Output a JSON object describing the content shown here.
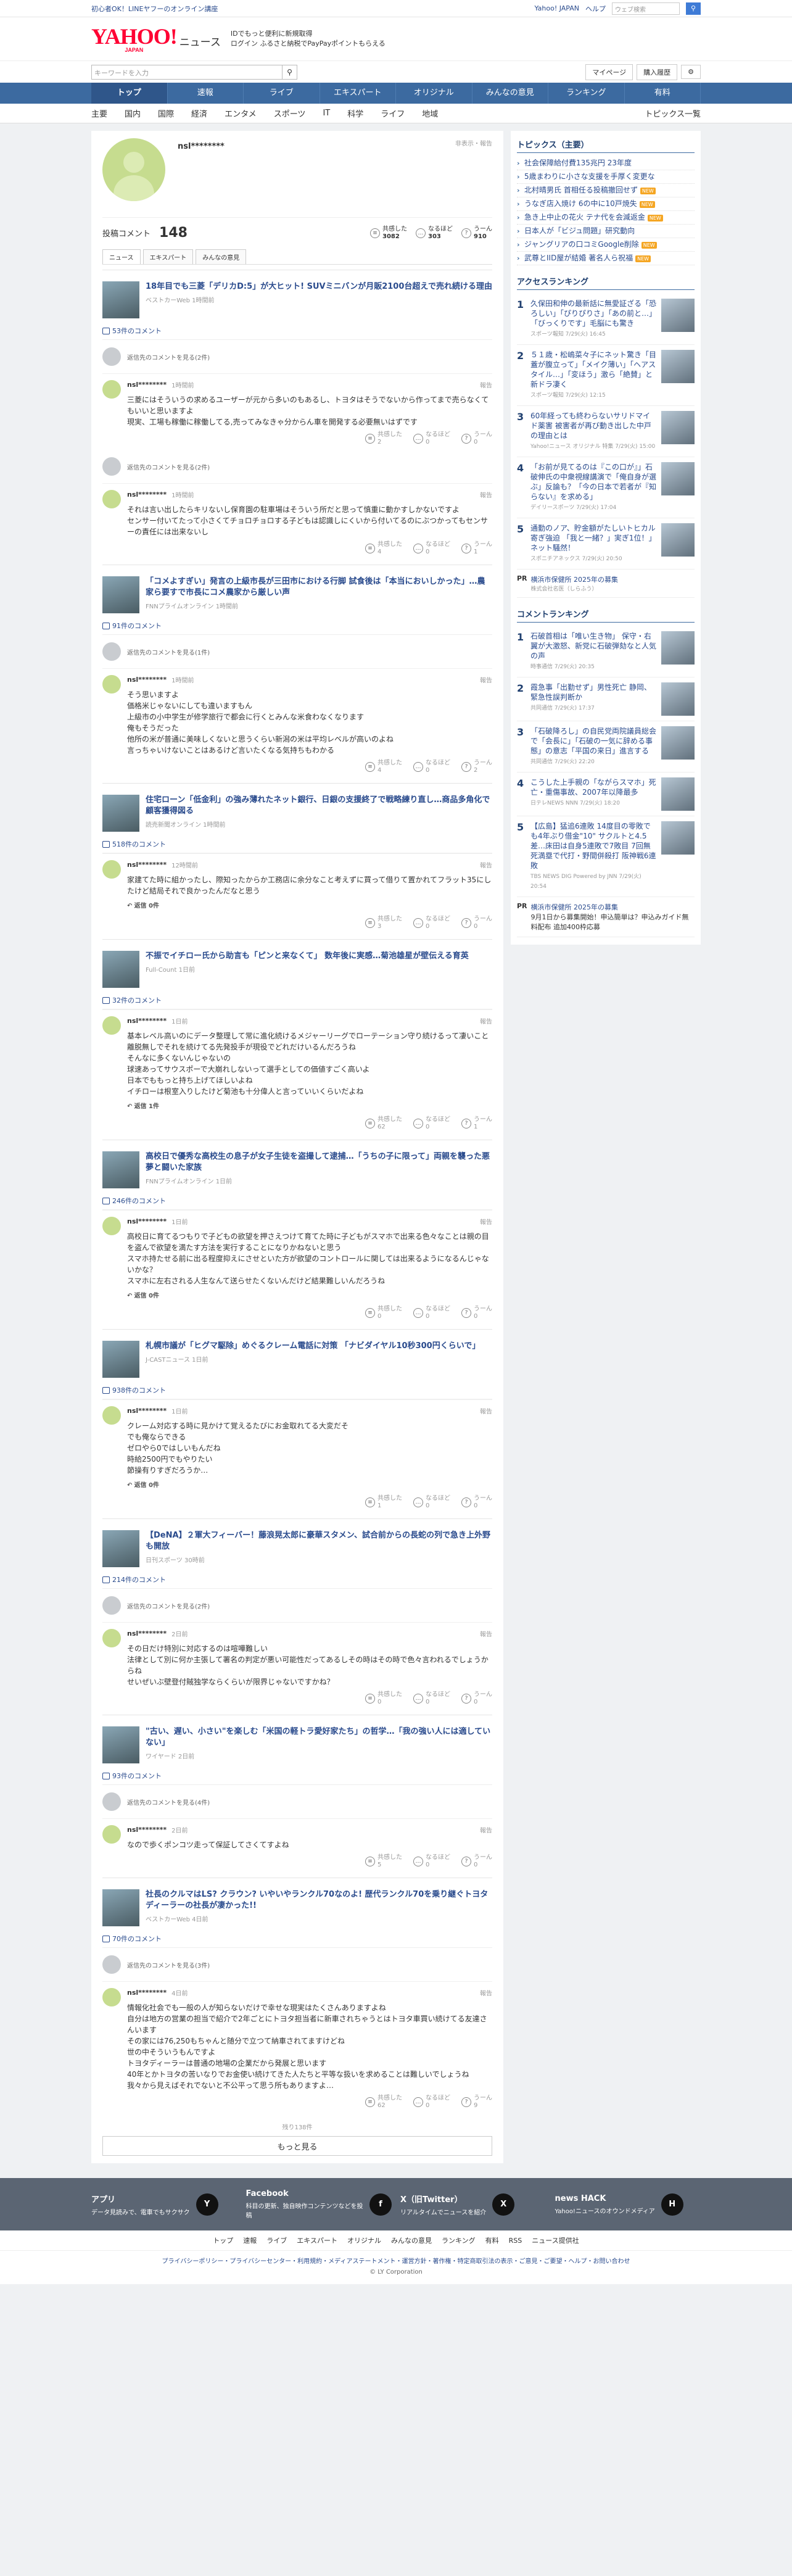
{
  "topbar": {
    "promo": "初心者OK！LINEヤフーのオンライン講座",
    "yj": "Yahoo! JAPAN",
    "help": "ヘルプ",
    "web_search": "ウェブ検索",
    "user": "多田さん"
  },
  "header": {
    "logo": "YAHOO!",
    "logo_sub": "JAPAN",
    "service": "ニュース",
    "promo1": "IDでもっと便利に新規取得",
    "promo2": "ログイン ふるさと納税でPayPayポイントもらえる"
  },
  "search": {
    "placeholder": "キーワードを入力",
    "mypage": "マイページ",
    "history": "購入履歴"
  },
  "nav": [
    "トップ",
    "速報",
    "ライブ",
    "エキスパート",
    "オリジナル",
    "みんなの意見",
    "ランキング",
    "有料"
  ],
  "categories": [
    "主要",
    "国内",
    "国際",
    "経済",
    "エンタメ",
    "スポーツ",
    "IT",
    "科学",
    "ライフ",
    "地域"
  ],
  "topics_list": "トピックス一覧",
  "profile": {
    "name": "nsl********",
    "report": "非表示・報告",
    "comment_label": "投稿コメント",
    "comment_count": "148",
    "reactions": [
      {
        "icon": "≡",
        "label": "共感した",
        "value": "3082"
      },
      {
        "icon": "…",
        "label": "なるほど",
        "value": "303"
      },
      {
        "icon": "?",
        "label": "うーん",
        "value": "910"
      }
    ],
    "tabs": [
      "ニュース",
      "エキスパート",
      "みんなの意見"
    ]
  },
  "threads": [
    {
      "title": "18年目でも三菱「デリカD:5」が大ヒット! SUVミニバンが月販2100台超えで売れ続ける理由",
      "source": "ベストカーWeb 1時間前",
      "count": "53件のコメント",
      "deleted": "返信先のコメントを見る(2件)",
      "time": "1時間前",
      "text": "三菱にはそういうの求めるユーザーが元から多いのもあるし、トヨタはそうでないから作ってまで売らなくてもいいと思いますよ\n現実、工場も稼働に稼働してる,売ってみなきゃ分からん車を開発する必要無いはずです",
      "r": [
        "2",
        "0",
        "0"
      ],
      "deleted2": "返信先のコメントを見る(2件)",
      "time2": "1時間前",
      "text2": "それは言い出したらキリないし保育園の駐車場はそういう所だと思って慎重に動かすしかないですよ\nセンサー付いてたって小さくてチョロチョロする子どもは認識しにくいから付いてるのにぶつかってもセンサーの責任には出来ないし",
      "r2": [
        "4",
        "0",
        "1"
      ]
    },
    {
      "title": "「コメよすぎい」発言の上級市長が三田市における行脚 試食後は「本当においしかった」…農家ら要すで市長にコメ農家から厳しい声",
      "source": "FNNプライムオンライン 1時間前",
      "count": "91件のコメント",
      "deleted": "返信先のコメントを見る(1件)",
      "time": "1時間前",
      "text": "そう思いますよ\n価格米じゃないにしても違いますもん\n上級市の小中学生が修学旅行で都会に行くとみんな米食わなくなります\n俺もそうだった\n他所の米が普通に美味しくないと思うくらい新潟の米は平均レベルが高いのよね\n言っちゃいけないことはあるけど言いたくなる気持ちもわかる",
      "r": [
        "4",
        "0",
        "2"
      ]
    },
    {
      "title": "住宅ローン「低金利」の強み薄れたネット銀行、日銀の支援終了で戦略練り直し…商品多角化で顧客獲得図る",
      "source": "読売新聞オンライン 1時間前",
      "count": "518件のコメント",
      "time": "12時間前",
      "text": "家建てた時に組かったし、際知ったからか工務店に余分なこと考えずに買って借りて置かれてフラット35にしたけど結局それで良かったんだなと思う",
      "reply": "返信 0件",
      "r": [
        "3",
        "0",
        "0"
      ]
    },
    {
      "title": "不振でイチロー氏から助言も「ピンと来なくて」 数年後に実感…菊池雄星が壁伝える育英",
      "source": "Full-Count 1日前",
      "count": "32件のコメント",
      "time": "1日前",
      "text": "基本レベル高いのにデータ整理して常に進化続けるメジャーリーグでローテーション守り続けるって凄いこと\n離脱無しでそれを続けてる先発投手が現役でどれだけいるんだろうね\nそんなに多くないんじゃないの\n球速あってサウスポーで大崩れしないって選手としての価値すごく高いよ\n日本でももっと持ち上げてほしいよね\nイチローは根室入りしたけど菊池も十分偉人と言っていいくらいだよね",
      "reply": "返信 1件",
      "r": [
        "62",
        "0",
        "1"
      ]
    },
    {
      "title": "高校日で優秀な高校生の息子が女子生徒を盗撮して逮捕…「うちの子に限って」両親を襲った悪夢と闘いた家族",
      "source": "FNNプライムオンライン 1日前",
      "count": "246件のコメント",
      "time": "1日前",
      "text": "高校日に育てるつもりで子どもの欲望を押さえつけて育てた時に子どもがスマホで出来る色々なことは親の目を盗んで欲望を満たす方法を実行することになりかねないと思う\nスマホ持たせる前に出る程度抑えにさせといた方が欲望のコントロールに関しては出来るようになるんじゃないかな？\nスマホに左右される人生なんて送らせたくないんだけど結果難しいんだろうね",
      "reply": "返信 0件",
      "r": [
        "0",
        "0",
        "0"
      ]
    },
    {
      "title": "札幌市議が「ヒグマ駆除」めぐるクレーム電話に対策 「ナビダイヤル10秒300円くらいで」",
      "source": "J-CASTニュース 1日前",
      "count": "938件のコメント",
      "time": "1日前",
      "text": "クレーム対応する時に見かけて覚えるたびにお金取れてる大変だそ\nでも俺ならできる\nゼロやら0ではしいもんだね\n時給2500円でもやりたい\n節操有りすぎだろうか…",
      "reply": "返信 0件",
      "r": [
        "1",
        "0",
        "0"
      ]
    },
    {
      "title": "【DeNA】２軍大フィーバー！藤浪晃太郎に豪華スタメン、試合前からの長蛇の列で急き上外野も開放",
      "source": "日刊スポーツ 30時前",
      "count": "214件のコメント",
      "deleted": "返信先のコメントを見る(2件)",
      "time": "2日前",
      "text": "その日だけ特別に対応するのは喧嘩難しい\n法律として別に何か主張して署名の判定が悪い可能性だってあるしその時はその時で色々言われるでしょうからね\nせいぜいぶ壁登付賊独学ならくらいが限界じゃないですかね？",
      "r": [
        "0",
        "0",
        "0"
      ]
    },
    {
      "title": "\"古い、遅い、小さい\"を楽しむ「米国の軽トラ愛好家たち」の哲学…「我の強い人には適していない」",
      "source": "ワイヤード 2日前",
      "count": "93件のコメント",
      "deleted": "返信先のコメントを見る(4件)",
      "time": "2日前",
      "text": "なので歩くポンコツ走って保証してさくてすよね",
      "r": [
        "5",
        "0",
        "0"
      ]
    },
    {
      "title": "社長のクルマはLS? クラウン? いやいやランクル70なのよ! 歴代ランクル70を乗り継ぐトヨタディーラーの社長が凄かった!!",
      "source": "ベストカーWeb 4日前",
      "count": "70件のコメント",
      "deleted": "返信先のコメントを見る(3件)",
      "time": "4日前",
      "text": "情報化社会でも一般の人が知らないだけで幸せな現実はたくさんありますよね\n自分は地方の営業の担当で紹介で2年ごとにトヨタ担当者に新車されちゃうとはトヨタ車買い続けてる友達さんいます\nその家には76,250もちゃんと随分で立つて納車されてますけどね\n世の中そういうもんですよ\nトヨタディーラーは普通の地場の企業だから発展と思います\n40年とかトヨタの苦いなりでお金使い続けてきた人たちと平等な扱いを求めることは難しいでしょうね\n我々から見えばそれでないと不公平って思う所もありますよ…",
      "r": [
        "62",
        "0",
        "9"
      ]
    }
  ],
  "remaining": "残り138件",
  "show_more": "もっと見る",
  "side": {
    "topics_title": "トピックス（主要）",
    "topics": [
      "社会保障給付費135兆円 23年度",
      "5歳まわりに小さな支援を手厚く変更な",
      "北村晴男氏 首相任る投稿撤回せず",
      "うなぎ店入焼け 6の中に10戸焼失",
      "急き上中止の花火 テナ代を会減返金",
      "日本人が「ビジュ問題」研究動向",
      "ジャングリアの口コミGoogle削除",
      "武尊とIID屋が結婚 著名人ら祝福"
    ],
    "topics_new": [
      false,
      false,
      true,
      true,
      true,
      false,
      true,
      true
    ],
    "access_title": "アクセスランキング",
    "access": [
      {
        "n": "1",
        "t": "久保田和伸の最新話に無愛証ざる「恐ろしい」「ぴりぴりさ」「あの前と…」「びっくりです」毛脳にも驚き",
        "s": "スポーツ報知 7/29(火) 16:45"
      },
      {
        "n": "2",
        "t": "５１歳・松嶋菜々子にネット驚き「目蓋が腹立って」「メイク薄い」「ヘアスタイル…」「変ほう」激ら「絶賛」と新ドラ凄く",
        "s": "スポーツ報知 7/29(火) 12:15"
      },
      {
        "n": "3",
        "t": "60年経っても終わらないサリドマイド薬害 被害者が再び動き出した中戸の理由とは",
        "s": "Yahoo!ニュース オリジナル 特集 7/29(火) 15:00"
      },
      {
        "n": "4",
        "t": "「お前が見てるのは『この口が』」石破伸氏の中衆視線講演で「俺自身が選ぶ」反論も？「今の日本で若者が『知らない』を求める」",
        "s": "デイリースポーツ 7/29(火) 17:04"
      },
      {
        "n": "5",
        "t": "通勤のノア、貯金額がたしいトヒカル寄ぎ強迫 「我と一緒？」実ぎ1位！」ネット騒然！",
        "s": "スポニチアネックス 7/29(火) 20:50"
      }
    ],
    "pr1_title": "横浜市保健所 2025年の募集",
    "pr1_src": "株式会社名医（しらふう）",
    "comment_title": "コメントランキング",
    "comment": [
      {
        "n": "1",
        "t": "石破首相は「唯い生き物」 保守・右翼が大激怒、新党に石破弾劾なと人気の声",
        "s": "時事通信 7/29(火) 20:35"
      },
      {
        "n": "2",
        "t": "霞急事「出勤せず」男性死亡 静岡、緊急性誤判断か",
        "s": "共同通信 7/29(火) 17:37"
      },
      {
        "n": "3",
        "t": "「石破降ろし」の自民党両院議員総会で「会長に」「石破の一気に辞める事態」の意志「平国の来日」進言する",
        "s": "共同通信 7/29(火) 22:20"
      },
      {
        "n": "4",
        "t": "こうした上手親の「ながらスマホ」死亡・重傷事故、2007年以降最多",
        "s": "日テレNEWS NNN 7/29(火) 18:20"
      },
      {
        "n": "5",
        "t": "【広島】猛追6連敗 14度目の零敗でも4年ぶり借金\"10\" サクルトと4.5差…床田は自身5連敗で7敗目 7回無死満塁で代打・野間併殺打 阪神戦6連敗",
        "s": "TBS NEWS DIG Powered by JNN 7/29(火) 20:54"
      }
    ],
    "pr2_title": "横浜市保健所 2025年の募集",
    "pr2_text": "9月1日から募集開始！申込簡単は？申込みガイド無料配布 追加400枠応募"
  },
  "footer": {
    "apps": [
      {
        "t": "アプリ",
        "d": "データ見読みで、電車でもサクサク",
        "i": "Y"
      },
      {
        "t": "Facebook",
        "d": "科目の更新、独自映作コンテンツなどを投稿",
        "i": "f"
      },
      {
        "t": "X（旧Twitter）",
        "d": "リアルタイムでニュースを紹介",
        "i": "X"
      },
      {
        "t": "news HACK",
        "d": "Yahoo!ニュースのオウンドメディア",
        "i": "H"
      }
    ],
    "links": [
      "トップ",
      "速報",
      "ライブ",
      "エキスパート",
      "オリジナル",
      "みんなの意見",
      "ランキング",
      "有料",
      "RSS",
      "ニュース提供社"
    ],
    "legal": "プライバシーポリシー・プライバシーセンター・利用規約・メディアステートメント・運営方針・著作権・特定商取引法の表示・ご意見・ご要望・ヘルプ・お問い合わせ",
    "copyright": "© LY Corporation"
  }
}
